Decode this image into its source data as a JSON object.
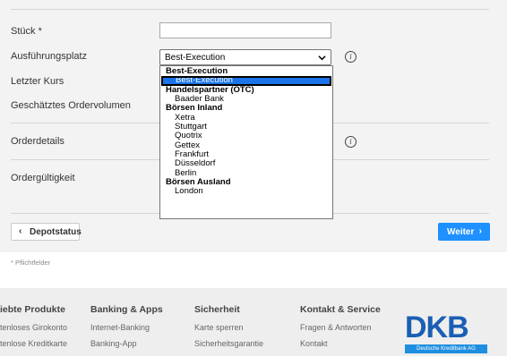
{
  "form": {
    "fields": {
      "stueck_label": "Stück *",
      "platz_label": "Ausführungsplatz",
      "platz_value": "Best-Execution",
      "kurs_label": "Letzter Kurs",
      "volumen_label": "Geschätztes Ordervolumen",
      "details_label": "Orderdetails",
      "gueltigkeit_label": "Ordergültigkeit"
    },
    "dropdown": [
      {
        "group": "Best-Execution",
        "options": [
          "Best-Execution"
        ]
      },
      {
        "group": "Handelspartner (OTC)",
        "options": [
          "Baader Bank"
        ]
      },
      {
        "group": "Börsen Inland",
        "options": [
          "Xetra",
          "Stuttgart",
          "Quotrix",
          "Gettex",
          "Frankfurt",
          "Düsseldorf",
          "Berlin"
        ]
      },
      {
        "group": "Börsen Ausland",
        "options": [
          "London"
        ]
      }
    ],
    "selected_option": "Best-Execution",
    "back_button": "Depotstatus",
    "next_button": "Weiter",
    "required_note": "* Pflichtfelder"
  },
  "footer": {
    "columns": [
      {
        "head": "iebte Produkte",
        "links": [
          "tenloses Girokonto",
          "tenlose Kreditkarte"
        ]
      },
      {
        "head": "Banking & Apps",
        "links": [
          "Internet-Banking",
          "Banking-App"
        ]
      },
      {
        "head": "Sicherheit",
        "links": [
          "Karte sperren",
          "Sicherheitsgarantie"
        ]
      },
      {
        "head": "Kontakt & Service",
        "links": [
          "Fragen & Antworten",
          "Kontakt"
        ]
      }
    ],
    "logo_text": "DKB",
    "logo_sub": "Deutsche Kreditbank AG"
  },
  "colors": {
    "accent": "#1e90ff",
    "logo": "#1a5fb4",
    "selected": "#1a73e8"
  }
}
